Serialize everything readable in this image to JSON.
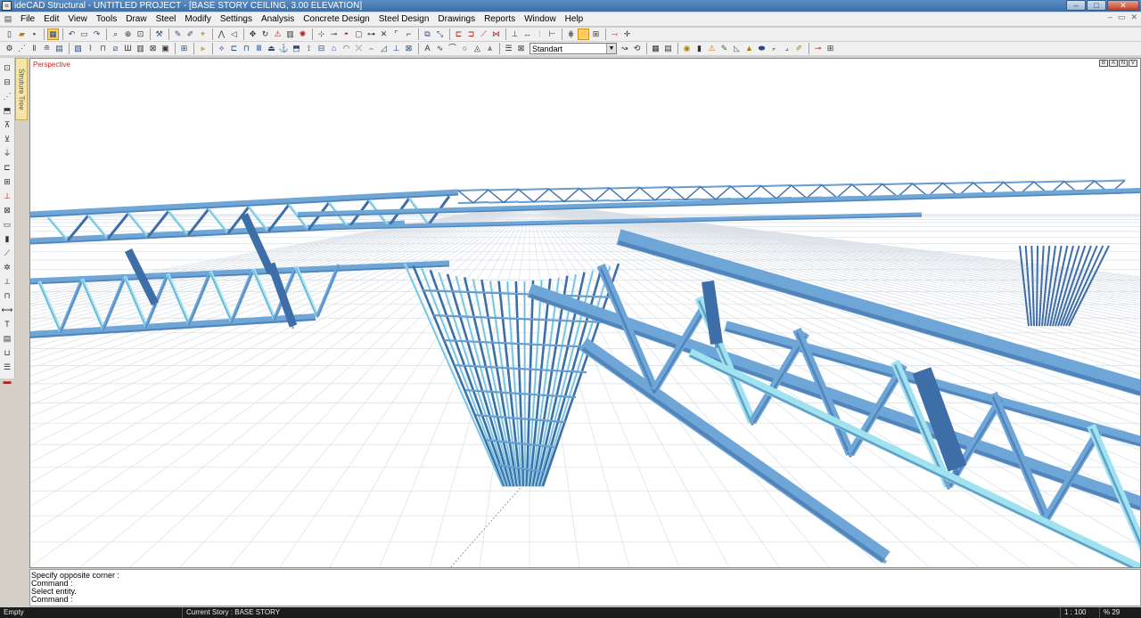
{
  "titlebar": {
    "title": "ideCAD Structural - UNTITLED PROJECT - [BASE STORY CEILING,  3.00 ELEVATION]",
    "minimize": "–",
    "maximize": "□",
    "close": "✕"
  },
  "menu": [
    "File",
    "Edit",
    "View",
    "Tools",
    "Draw",
    "Steel",
    "Modify",
    "Settings",
    "Analysis",
    "Concrete Design",
    "Steel Design",
    "Drawings",
    "Reports",
    "Window",
    "Help"
  ],
  "toolbar": {
    "style_combo": "Standart"
  },
  "sidebar": {
    "structure_tree_tab": "Struture Tree"
  },
  "viewport": {
    "label": "Perspective",
    "view_controls": [
      "B",
      "A",
      "N",
      "V"
    ]
  },
  "command_lines": [
    "Specify opposite corner :",
    "Command :",
    "Select entity.",
    "Command :"
  ],
  "status": {
    "mode": "Empty",
    "story": "Current Story : BASE STORY",
    "scale": "1 : 100",
    "zoom": "% 29"
  },
  "colors": {
    "beam_light": "#9fe3f0",
    "beam_mid": "#6fa6d8",
    "beam_dark": "#3d6ea8",
    "grid": "#d9dfe6"
  }
}
